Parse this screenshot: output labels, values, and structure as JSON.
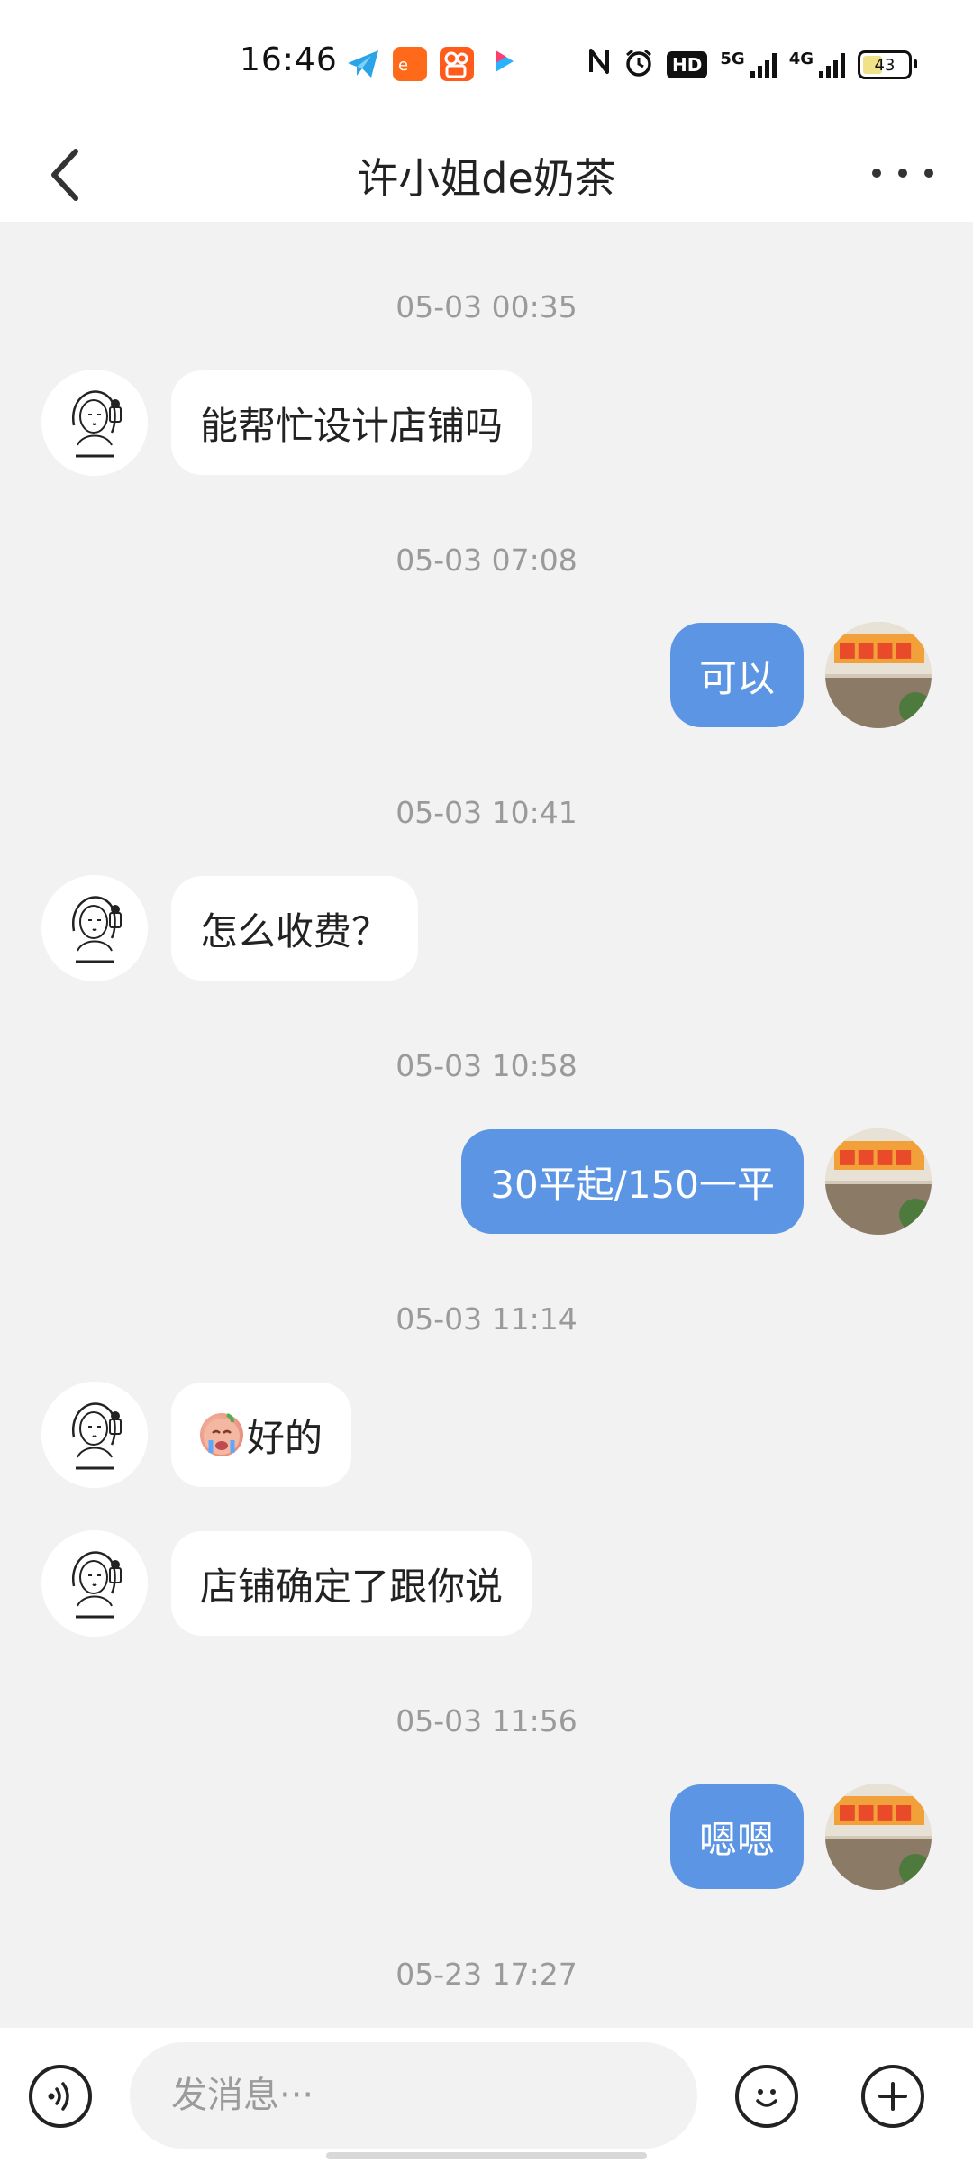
{
  "status_bar": {
    "time": "16:46",
    "apps": [
      "telegram-app-icon",
      "ali-app-icon",
      "kuaishou-app-icon",
      "youku-app-icon"
    ],
    "net1": "5G",
    "net2": "4G",
    "hd": "HD",
    "battery": "43",
    "battery_level": 0.43
  },
  "header": {
    "title": "许小姐de奶茶"
  },
  "messages": [
    {
      "type": "timestamp",
      "text": "05-03 00:35"
    },
    {
      "type": "msg",
      "side": "left",
      "text": "能帮忙设计店铺吗"
    },
    {
      "type": "timestamp",
      "text": "05-03 07:08"
    },
    {
      "type": "msg",
      "side": "right",
      "text": "可以"
    },
    {
      "type": "timestamp",
      "text": "05-03 10:41"
    },
    {
      "type": "msg",
      "side": "left",
      "text": "怎么收费？"
    },
    {
      "type": "timestamp",
      "text": "05-03 10:58"
    },
    {
      "type": "msg",
      "side": "right",
      "text": "30平起/150一平"
    },
    {
      "type": "timestamp",
      "text": "05-03 11:14"
    },
    {
      "type": "msg",
      "side": "left",
      "text": "好的",
      "emoji": "crying-face-emoji"
    },
    {
      "type": "msg",
      "side": "left",
      "text": "店铺确定了跟你说"
    },
    {
      "type": "timestamp",
      "text": "05-03 11:56"
    },
    {
      "type": "msg",
      "side": "right",
      "text": "嗯嗯"
    },
    {
      "type": "timestamp",
      "text": "05-23 17:27"
    }
  ],
  "input": {
    "placeholder": "发消息···"
  },
  "colors": {
    "background": "#f2f2f2",
    "bubble_right": "#5b95e3",
    "bubble_left": "#ffffff",
    "timestamp": "#9a9a9a"
  }
}
